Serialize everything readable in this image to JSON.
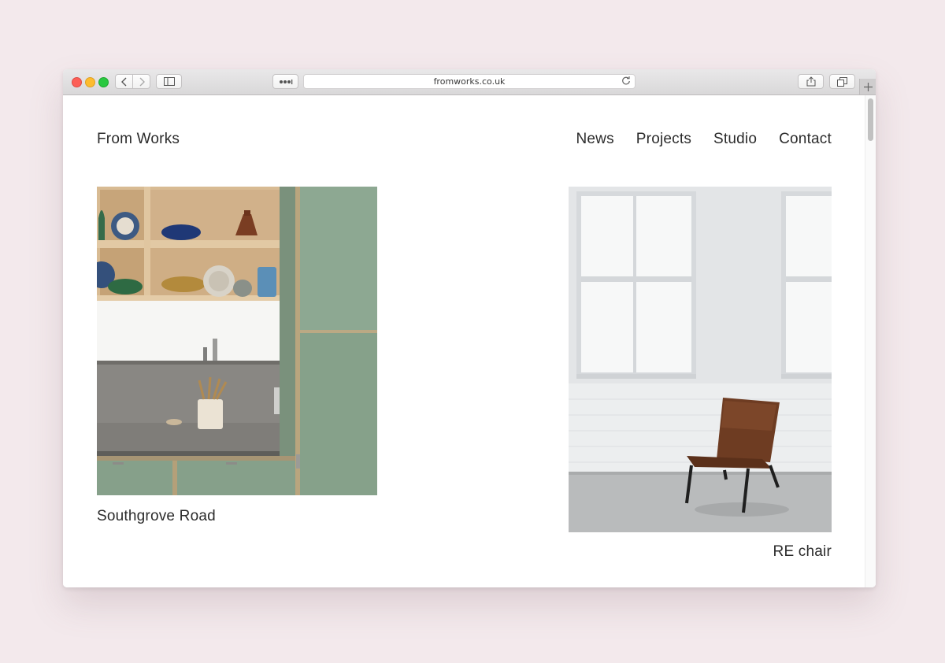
{
  "browser": {
    "url": "fromworks.co.uk",
    "icons": [
      "back-icon",
      "forward-icon",
      "sidebar-icon",
      "more-icon",
      "reload-icon",
      "share-icon",
      "tabs-icon",
      "plus-icon"
    ]
  },
  "site": {
    "logo": "From Works",
    "nav": [
      {
        "label": "News"
      },
      {
        "label": "Projects"
      },
      {
        "label": "Studio"
      },
      {
        "label": "Contact"
      }
    ]
  },
  "projects": [
    {
      "title": "Southgrove Road",
      "image_subject": "kitchen-photo"
    },
    {
      "title": "RE chair",
      "image_subject": "chair-photo"
    }
  ],
  "colors": {
    "page_background": "#f3e9ec",
    "text": "#2b2b2b",
    "traffic_red": "#fc5f57",
    "traffic_yellow": "#fdbc2e",
    "traffic_green": "#29c840"
  }
}
